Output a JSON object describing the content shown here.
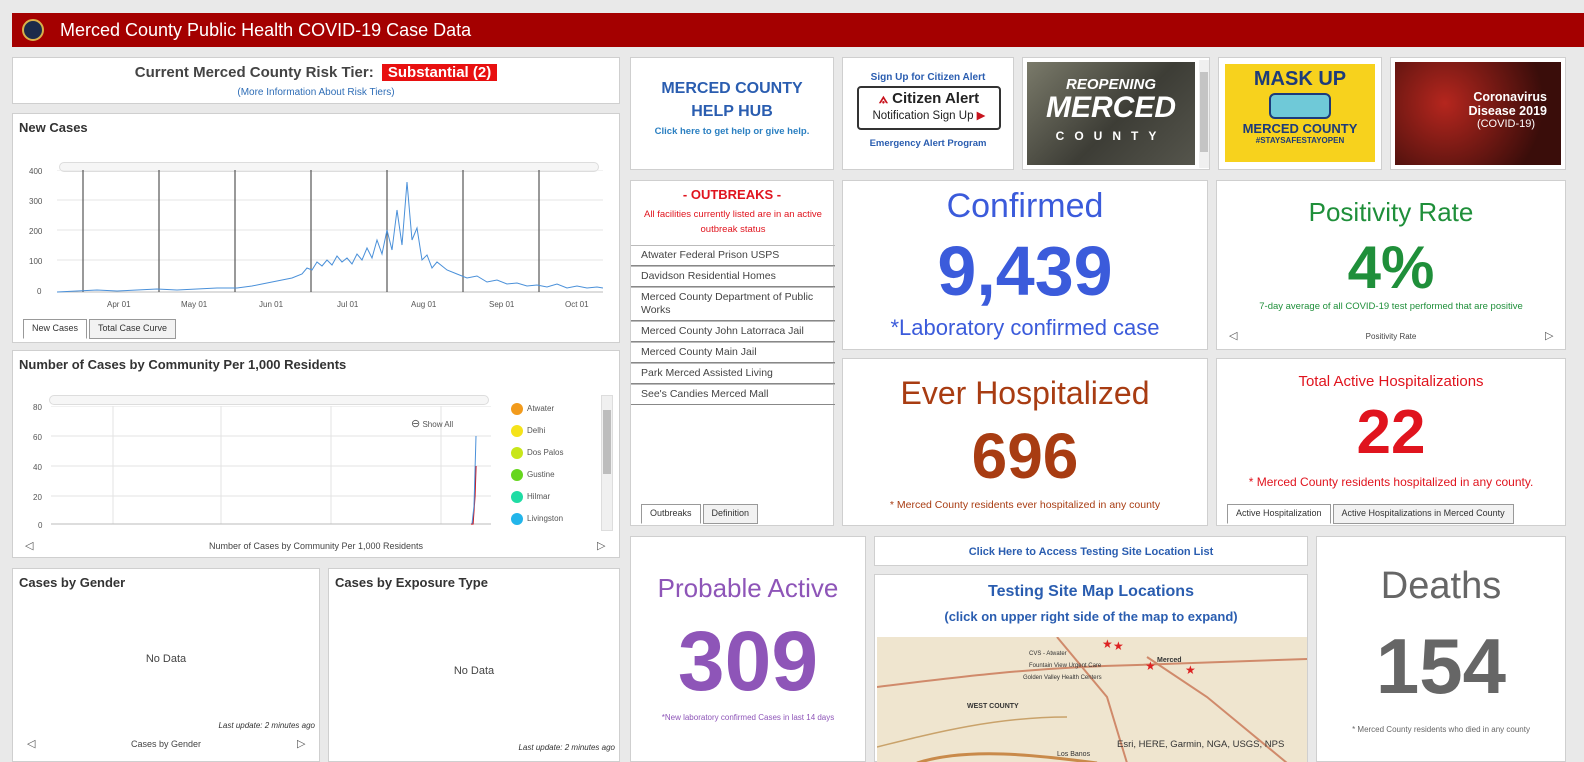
{
  "header": {
    "title": "Merced County Public Health COVID-19 Case Data"
  },
  "risk_tier": {
    "label": "Current Merced County Risk Tier:",
    "value": "Substantial (2)",
    "link": "(More Information About Risk Tiers)"
  },
  "new_cases": {
    "title": "New Cases",
    "tabs": [
      "New Cases",
      "Total Case Curve"
    ],
    "y_ticks": [
      "400",
      "300",
      "200",
      "100",
      "0"
    ],
    "x_ticks": [
      "Apr 01",
      "May 01",
      "Jun 01",
      "Jul 01",
      "Aug 01",
      "Sep 01",
      "Oct 01"
    ],
    "line_color": "#4a90d9"
  },
  "community": {
    "title": "Number of Cases by Community Per 1,000 Residents",
    "y_ticks": [
      "80",
      "60",
      "40",
      "20",
      "0"
    ],
    "show_all": "Show All",
    "legend": [
      {
        "name": "Atwater",
        "color": "#f29b1c"
      },
      {
        "name": "Delhi",
        "color": "#f5e31a"
      },
      {
        "name": "Dos Palos",
        "color": "#c8e61a"
      },
      {
        "name": "Gustine",
        "color": "#66d61e"
      },
      {
        "name": "Hilmar",
        "color": "#1fdca4"
      },
      {
        "name": "Livingston",
        "color": "#22b5ea"
      }
    ],
    "footer": "Number of Cases by Community Per 1,000 Residents"
  },
  "gender": {
    "title": "Cases by Gender",
    "no_data": "No Data",
    "last_update": "Last update: 2 minutes ago",
    "footer": "Cases by Gender"
  },
  "exposure": {
    "title": "Cases by Exposure Type",
    "no_data": "No Data",
    "last_update": "Last update: 2 minutes ago"
  },
  "help_hub": {
    "line1": "MERCED COUNTY",
    "line2": "HELP HUB",
    "sub": "Click here to get help or give help."
  },
  "citizen_alert": {
    "top": "Sign Up for Citizen Alert",
    "brand": "Citizen Alert",
    "notice": "Notification Sign Up",
    "bottom": "Emergency Alert Program"
  },
  "reopening": {
    "line1": "REOPENING",
    "line2": "MERCED",
    "line3": "COUNTY"
  },
  "mask_up": {
    "line1": "MASK UP",
    "line2": "MERCED COUNTY",
    "line3": "#STAYSAFESTAYOPEN"
  },
  "coronavirus": {
    "line1": "Coronavirus",
    "line2": "Disease 2019",
    "line3": "(COVID-19)"
  },
  "outbreaks": {
    "title": "- OUTBREAKS -",
    "note": "All facilities currently listed are in an active outbreak status",
    "items": [
      "Atwater Federal Prison USPS",
      "Davidson Residential Homes",
      "Merced County Department of Public Works",
      "Merced County John Latorraca Jail",
      "Merced County Main Jail",
      "Park Merced Assisted Living",
      "See's Candies Merced Mall"
    ],
    "tabs": [
      "Outbreaks",
      "Definition"
    ]
  },
  "confirmed": {
    "label": "Confirmed",
    "value": "9,439",
    "note": "*Laboratory confirmed case",
    "color": "#3b5bdb"
  },
  "positivity": {
    "label": "Positivity Rate",
    "value": "4%",
    "note": "7-day average of all COVID-19 test performed that are positive",
    "footer": "Positivity Rate",
    "color": "#1f8f3a"
  },
  "hospitalized": {
    "label": "Ever Hospitalized",
    "value": "696",
    "note": "* Merced County residents ever hospitalized in any county",
    "color": "#a83c12"
  },
  "active_hosp": {
    "label": "Total Active Hospitalizations",
    "value": "22",
    "note": "* Merced County residents hospitalized in any county.",
    "tabs": [
      "Active Hospitalization",
      "Active Hospitalizations in Merced County"
    ],
    "color": "#e0141e"
  },
  "probable": {
    "label": "Probable Active",
    "value": "309",
    "note": "*New laboratory confirmed Cases in last 14 days",
    "color": "#8e55b8"
  },
  "testing": {
    "link": "Click Here to Access Testing Site Location List",
    "map_title": "Testing Site Map Locations",
    "map_sub": "(click on upper right side of the map to expand)",
    "map_labels": [
      "CVS - Atwater",
      "Fountain View Urgent Care",
      "Golden Valley Health Centers",
      "Merced",
      "WEST COUNTY",
      "Los Banos"
    ],
    "attribution": "Esri, HERE, Garmin, NGA, USGS, NPS"
  },
  "deaths": {
    "label": "Deaths",
    "value": "154",
    "note": "* Merced County residents who died in any county",
    "color": "#666666"
  }
}
